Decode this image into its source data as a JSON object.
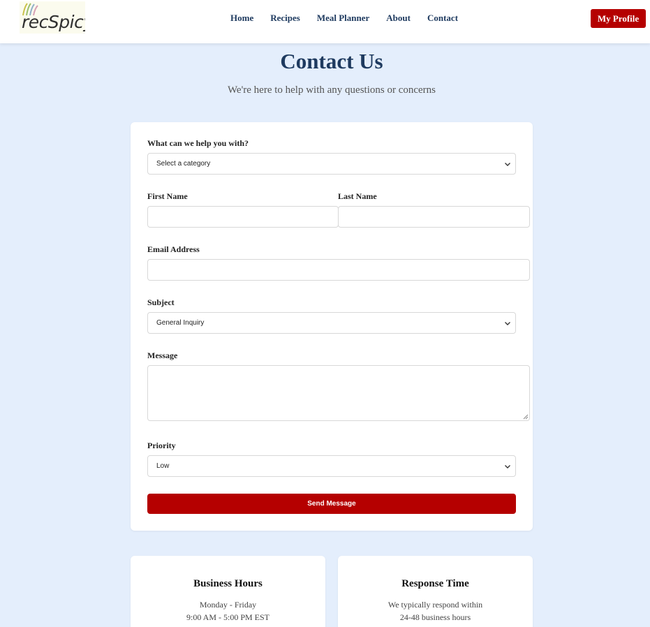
{
  "header": {
    "logo_text": "recSpicy",
    "nav": [
      {
        "label": "Home"
      },
      {
        "label": "Recipes"
      },
      {
        "label": "Meal Planner"
      },
      {
        "label": "About"
      },
      {
        "label": "Contact"
      }
    ],
    "profile_label": "My Profile"
  },
  "hero": {
    "title": "Contact Us",
    "subtitle": "We're here to help with any questions or concerns"
  },
  "form": {
    "category_label": "What can we help you with?",
    "category_value": "Select a category",
    "first_name_label": "First Name",
    "first_name_value": "",
    "last_name_label": "Last Name",
    "last_name_value": "",
    "email_label": "Email Address",
    "email_value": "",
    "subject_label": "Subject",
    "subject_value": "General Inquiry",
    "message_label": "Message",
    "message_value": "",
    "priority_label": "Priority",
    "priority_value": "Low",
    "submit_label": "Send Message"
  },
  "info_cards": [
    {
      "title": "Business Hours",
      "line1": "Monday - Friday",
      "line2": "9:00 AM - 5:00 PM EST"
    },
    {
      "title": "Response Time",
      "line1": "We typically respond within",
      "line2": "24-48 business hours"
    }
  ],
  "colors": {
    "brand_red": "#b50000",
    "navy": "#1e3a5f",
    "page_bg": "#e4eefc"
  },
  "icons": {
    "select_arrow": "chevron-down-icon",
    "textarea_resize": "resize-grip-icon"
  }
}
